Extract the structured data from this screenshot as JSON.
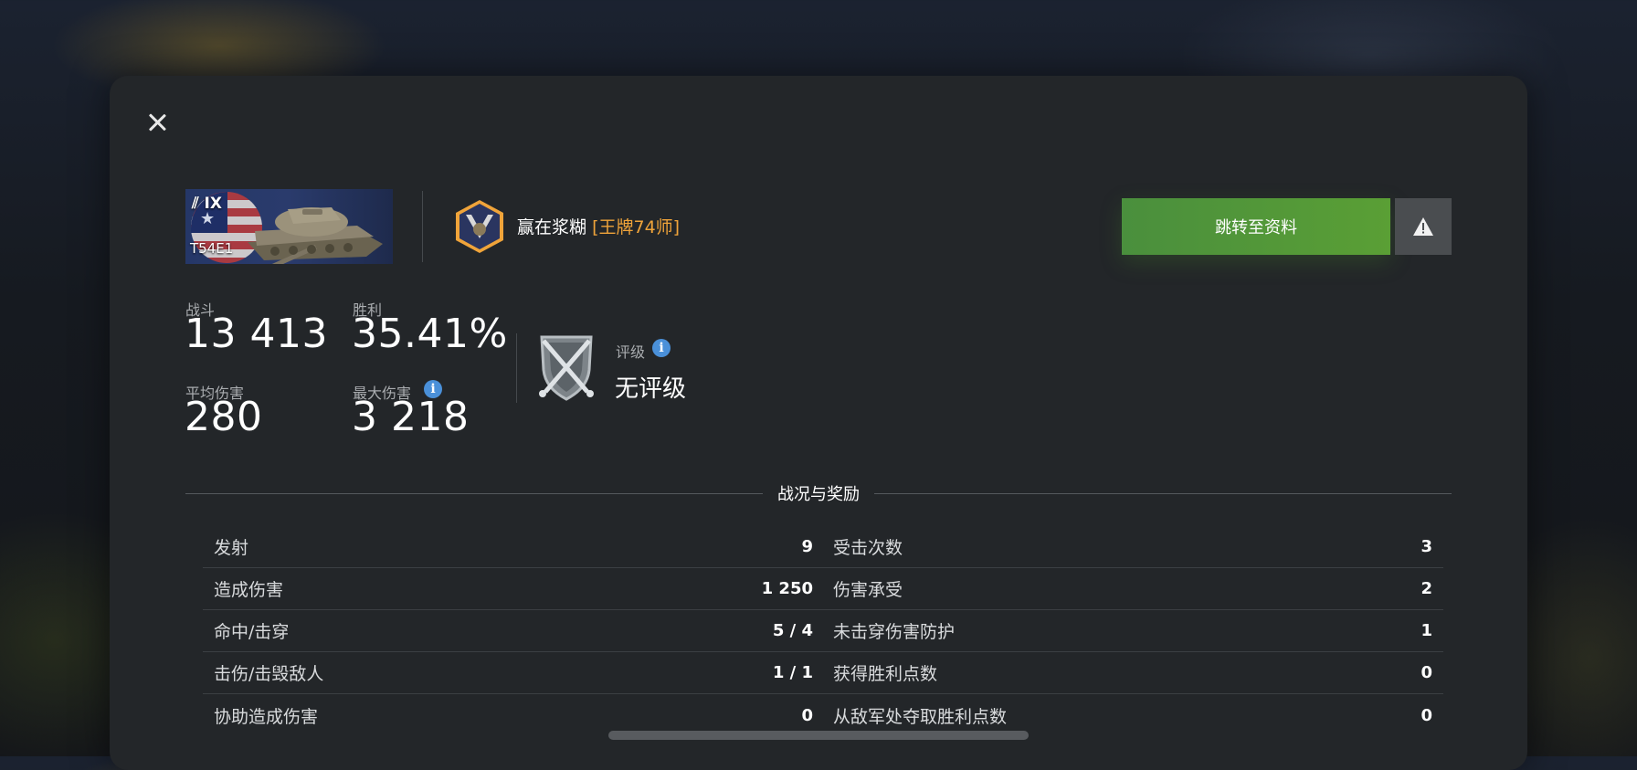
{
  "tank": {
    "tier": "IX",
    "name": "T54E1"
  },
  "player": {
    "name": "赢在浆糊",
    "clan": "[王牌74师]"
  },
  "buttons": {
    "goto_profile": "跳转至资料"
  },
  "stats": {
    "battles_label": "战斗",
    "battles": "13 413",
    "wins_label": "胜利",
    "wins": "35.41%",
    "avg_damage_label": "平均伤害",
    "avg_damage": "280",
    "max_damage_label": "最大伤害",
    "max_damage": "3 218"
  },
  "rating": {
    "label": "评级",
    "value": "无评级"
  },
  "section_title": "战况与奖励",
  "left_rows": [
    {
      "label": "发射",
      "value": "9"
    },
    {
      "label": "造成伤害",
      "value": "1 250"
    },
    {
      "label": "命中/击穿",
      "value": "5 / 4"
    },
    {
      "label": "击伤/击毁敌人",
      "value": "1 / 1"
    },
    {
      "label": "协助造成伤害",
      "value": "0"
    }
  ],
  "right_rows": [
    {
      "label": "受击次数",
      "value": "3"
    },
    {
      "label": "伤害承受",
      "value": "2"
    },
    {
      "label": "未击穿伤害防护",
      "value": "1"
    },
    {
      "label": "获得胜利点数",
      "value": "0"
    },
    {
      "label": "从敌军处夺取胜利点数",
      "value": "0"
    }
  ],
  "colors": {
    "accent_green": "#4a8f3d",
    "clan_orange": "#f0a43a",
    "info_blue": "#4a90d9"
  },
  "icons": [
    "close-icon",
    "warning-icon",
    "info-icon",
    "clan-emblem-icon",
    "rating-emblem-icon",
    "tank-icon"
  ]
}
